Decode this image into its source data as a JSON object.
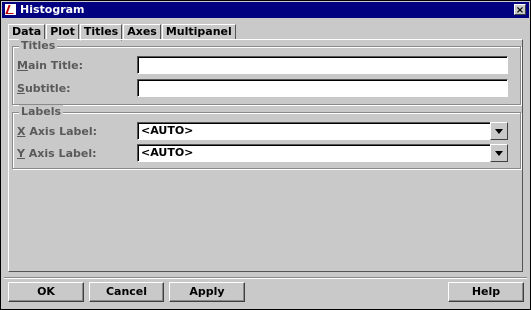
{
  "window": {
    "title": "Histogram",
    "close_label": "×"
  },
  "tabs": [
    {
      "label": "Data"
    },
    {
      "label": "Plot"
    },
    {
      "label": "Titles"
    },
    {
      "label": "Axes"
    },
    {
      "label": "Multipanel"
    }
  ],
  "active_tab": "Titles",
  "titles_group": {
    "title": "Titles",
    "main_title": {
      "label_key": "M",
      "label_rest": "ain Title:",
      "value": ""
    },
    "subtitle": {
      "label_key": "S",
      "label_rest": "ubtitle:",
      "value": ""
    }
  },
  "labels_group": {
    "title": "Labels",
    "x_axis": {
      "label_key": "X",
      "label_rest": " Axis Label:",
      "value": "<AUTO>"
    },
    "y_axis": {
      "label_key": "Y",
      "label_rest": " Axis Label:",
      "value": "<AUTO>"
    }
  },
  "buttons": {
    "ok": "OK",
    "cancel": "Cancel",
    "apply": "Apply",
    "help": "Help"
  }
}
